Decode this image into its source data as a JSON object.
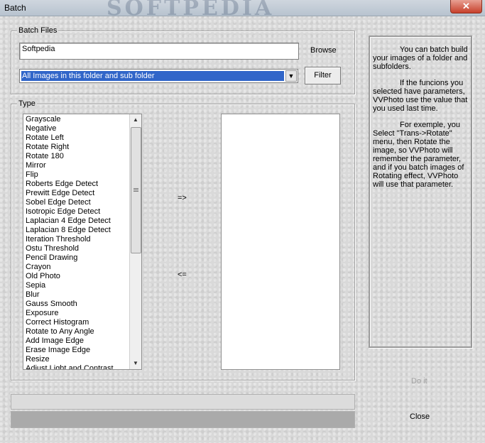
{
  "window": {
    "title": "Batch",
    "watermark": "SOFTPEDIA",
    "close_symbol": "✕"
  },
  "batch_files": {
    "group_label": "Batch Files",
    "path_value": "Softpedia",
    "browse_label": "Browse",
    "filter_selected": "All Images in this folder and sub folder",
    "filter_button": "Filter"
  },
  "type": {
    "group_label": "Type",
    "available": [
      "Grayscale",
      "Negative",
      "Rotate Left",
      "Rotate Right",
      "Rotate 180",
      "Mirror",
      "Flip",
      "Roberts Edge Detect",
      "Prewitt Edge Detect",
      "Sobel Edge Detect",
      "Isotropic Edge Detect",
      "Laplacian 4 Edge Detect",
      "Laplacian 8 Edge Detect",
      "Iteration Threshold",
      "Ostu Threshold",
      "Pencil Drawing",
      "Crayon",
      "Old Photo",
      "Sepia",
      "Blur",
      "Gauss Smooth",
      "Exposure",
      "Correct Histogram",
      "Rotate to Any Angle",
      "Add Image Edge",
      "Erase Image Edge",
      "Resize",
      "Adjust Light and Contrast"
    ],
    "add_arrow": "=>",
    "remove_arrow": "<=",
    "selected": []
  },
  "info": {
    "p1": "You can batch build your images of a folder and subfolders.",
    "p2": "If the funcions you selected have parameters, VVPhoto use the value that you used last time.",
    "p3": "For exemple, you Select \"Trans->Rotate\" menu, then Rotate the image, so VVPhoto will remember the parameter, and if you batch images of Rotating effect, VVPhoto will use that parameter."
  },
  "actions": {
    "do_it": "Do it",
    "close": "Close"
  }
}
